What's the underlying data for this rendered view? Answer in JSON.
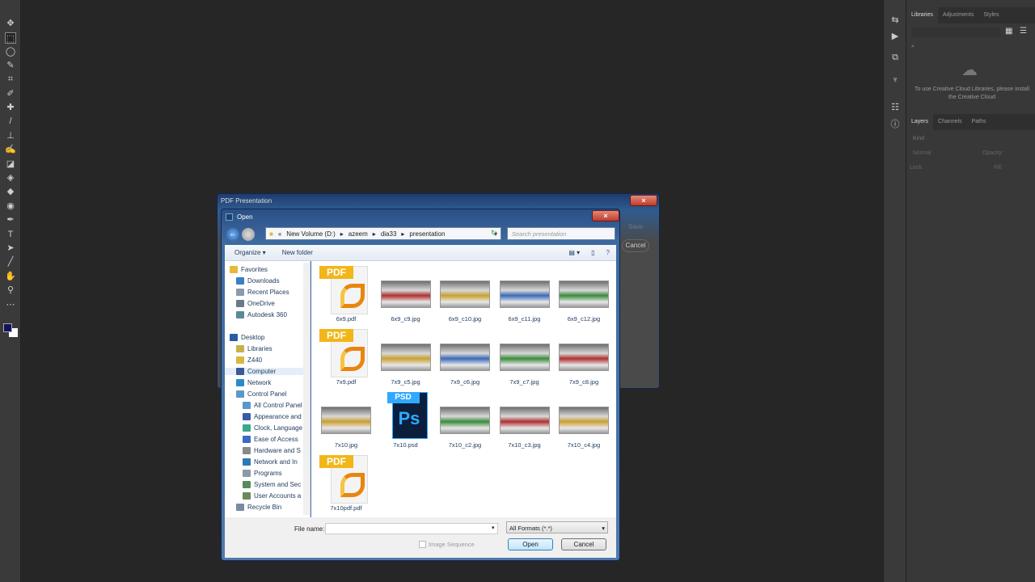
{
  "photoshop": {
    "tools": [
      "move-tool",
      "marquee-tool",
      "lasso-tool",
      "quick-select-tool",
      "crop-tool",
      "eyedropper-tool",
      "healing-tool",
      "brush-tool",
      "stamp-tool",
      "history-brush-tool",
      "eraser-tool",
      "bucket-tool",
      "blur-tool",
      "dodge-tool",
      "pen-tool",
      "type-tool",
      "path-select-tool",
      "line-tool",
      "hand-tool",
      "zoom-tool",
      "more-tool"
    ],
    "foreground_color": "#14125a",
    "background_color": "#ffffff",
    "libraries_tabs": [
      "Libraries",
      "Adjustments",
      "Styles"
    ],
    "libraries_message": "To use Creative Cloud Libraries, please install the Creative Cloud",
    "layers_tabs": [
      "Layers",
      "Channels",
      "Paths"
    ],
    "layers_kind": "Kind",
    "blend_mode": "Normal",
    "opacity_label": "Opacity:",
    "lock_label": "Lock:",
    "fill_label": "Fill:"
  },
  "pdf_dialog": {
    "title": "PDF Presentation",
    "save": "Save",
    "cancel": "Cancel"
  },
  "open_dialog": {
    "title": "Open",
    "breadcrumb": [
      "New Volume (D:)",
      "azeem",
      "dia33",
      "presentation"
    ],
    "search_placeholder": "Search presentation",
    "organize": "Organize ▾",
    "new_folder": "New folder",
    "nav": [
      {
        "label": "Favorites",
        "level": 0,
        "color": "#e8b83a"
      },
      {
        "label": "Downloads",
        "level": 1,
        "color": "#3b7fc4"
      },
      {
        "label": "Recent Places",
        "level": 1,
        "color": "#8a9bb0"
      },
      {
        "label": "OneDrive",
        "level": 1,
        "color": "#6a7a8a"
      },
      {
        "label": "Autodesk 360",
        "level": 1,
        "color": "#5a8a9a"
      },
      {
        "label": "",
        "level": 0,
        "color": ""
      },
      {
        "label": "Desktop",
        "level": 0,
        "color": "#2a5aa8"
      },
      {
        "label": "Libraries",
        "level": 1,
        "color": "#c9b04a"
      },
      {
        "label": "Z440",
        "level": 1,
        "color": "#d8b840"
      },
      {
        "label": "Computer",
        "level": 1,
        "color": "#3a5a9a"
      },
      {
        "label": "Network",
        "level": 1,
        "color": "#2a8ac8"
      },
      {
        "label": "Control Panel",
        "level": 1,
        "color": "#5a9ac8"
      },
      {
        "label": "All Control Panel",
        "level": 2,
        "color": "#5a9ac8"
      },
      {
        "label": "Appearance and",
        "level": 2,
        "color": "#3a5aa8"
      },
      {
        "label": "Clock, Language",
        "level": 2,
        "color": "#3aa88a"
      },
      {
        "label": "Ease of Access",
        "level": 2,
        "color": "#3a6ac8"
      },
      {
        "label": "Hardware and S",
        "level": 2,
        "color": "#8a8a8a"
      },
      {
        "label": "Network and In",
        "level": 2,
        "color": "#2a7ab8"
      },
      {
        "label": "Programs",
        "level": 2,
        "color": "#8a9aa8"
      },
      {
        "label": "System and Sec",
        "level": 2,
        "color": "#5a8a5a"
      },
      {
        "label": "User Accounts a",
        "level": 2,
        "color": "#6a8a5a"
      },
      {
        "label": "Recycle Bin",
        "level": 1,
        "color": "#7a8aa0"
      }
    ],
    "files": [
      {
        "name": "6x9.pdf",
        "type": "pdf"
      },
      {
        "name": "6x9_c9.jpg",
        "type": "jpg"
      },
      {
        "name": "6x9_c10.jpg",
        "type": "jpg"
      },
      {
        "name": "6x9_c11.jpg",
        "type": "jpg"
      },
      {
        "name": "6x9_c12.jpg",
        "type": "jpg"
      },
      {
        "name": "7x9.pdf",
        "type": "pdf"
      },
      {
        "name": "7x9_c5.jpg",
        "type": "jpg"
      },
      {
        "name": "7x9_c6.jpg",
        "type": "jpg"
      },
      {
        "name": "7x9_c7.jpg",
        "type": "jpg"
      },
      {
        "name": "7x9_c8.jpg",
        "type": "jpg"
      },
      {
        "name": "7x10.jpg",
        "type": "jpg"
      },
      {
        "name": "7x10.psd",
        "type": "psd"
      },
      {
        "name": "7x10_c2.jpg",
        "type": "jpg"
      },
      {
        "name": "7x10_c3.jpg",
        "type": "jpg"
      },
      {
        "name": "7x10_c4.jpg",
        "type": "jpg"
      },
      {
        "name": "7x10pdf.pdf",
        "type": "pdf"
      }
    ],
    "pdf_badge": "PDF",
    "psd_badge": "PSD",
    "ps_label": "Ps",
    "file_name_label": "File name:",
    "file_name_value": "",
    "format": "All Formats (*.*)",
    "image_sequence": "Image Sequence",
    "open": "Open",
    "cancel": "Cancel"
  }
}
